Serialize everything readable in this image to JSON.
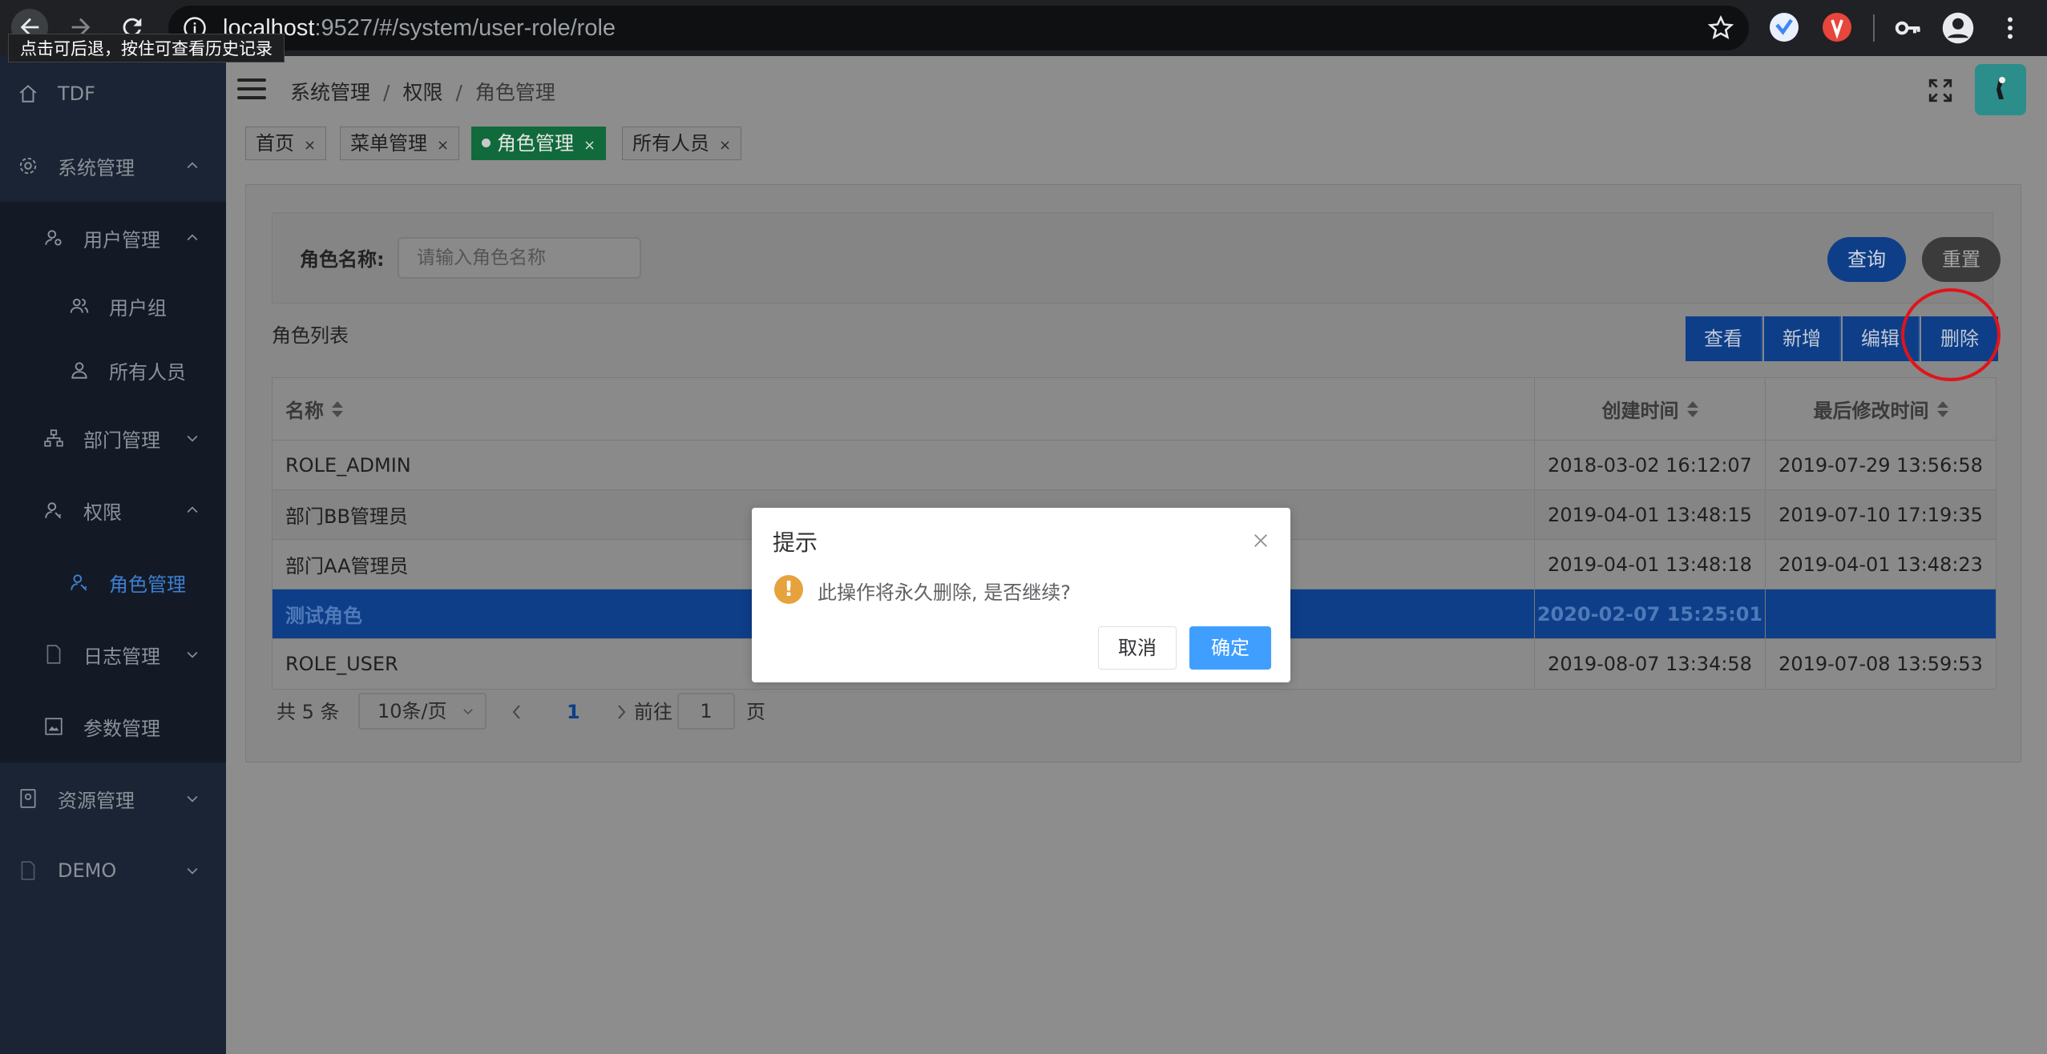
{
  "browser": {
    "url_host": "localhost",
    "url_rest": ":9527/#/system/user-role/role",
    "tooltip": "点击可后退，按住可查看历史记录"
  },
  "sidebar": {
    "items": [
      {
        "label": "TDF",
        "icon": "home-icon"
      },
      {
        "label": "系统管理",
        "icon": "gear-icon"
      },
      {
        "label": "用户管理",
        "icon": "user-gear-icon"
      },
      {
        "label": "用户组",
        "icon": "users-icon"
      },
      {
        "label": "所有人员",
        "icon": "user-icon"
      },
      {
        "label": "部门管理",
        "icon": "org-icon"
      },
      {
        "label": "权限",
        "icon": "user-key-icon"
      },
      {
        "label": "角色管理",
        "icon": "user-key-icon"
      },
      {
        "label": "日志管理",
        "icon": "doc-icon"
      },
      {
        "label": "参数管理",
        "icon": "picture-icon"
      },
      {
        "label": "资源管理",
        "icon": "book-icon"
      },
      {
        "label": "DEMO",
        "icon": "doc-icon"
      }
    ]
  },
  "breadcrumb": {
    "items": [
      "系统管理",
      "权限",
      "角色管理"
    ],
    "sep": "/"
  },
  "tags": [
    {
      "label": "首页",
      "close": "×"
    },
    {
      "label": "菜单管理",
      "close": "×"
    },
    {
      "label": "角色管理",
      "close": "×"
    },
    {
      "label": "所有人员",
      "close": "×"
    }
  ],
  "filter": {
    "label": "角色名称:",
    "placeholder": "请输入角色名称",
    "query_label": "查询",
    "reset_label": "重置"
  },
  "list": {
    "title": "角色列表",
    "actions": [
      "查看",
      "新增",
      "编辑",
      "删除"
    ],
    "columns": [
      "名称",
      "创建时间",
      "最后修改时间"
    ],
    "rows": [
      {
        "name": "ROLE_ADMIN",
        "created": "2018-03-02 16:12:07",
        "modified": "2019-07-29 13:56:58"
      },
      {
        "name": "部门BB管理员",
        "created": "2019-04-01 13:48:15",
        "modified": "2019-07-10 17:19:35"
      },
      {
        "name": "部门AA管理员",
        "created": "2019-04-01 13:48:18",
        "modified": "2019-04-01 13:48:23"
      },
      {
        "name": "测试角色",
        "created": "2020-02-07 15:25:01",
        "modified": ""
      },
      {
        "name": "ROLE_USER",
        "created": "2019-08-07 13:34:58",
        "modified": "2019-07-08 13:59:53"
      }
    ]
  },
  "pagination": {
    "total": "共 5 条",
    "page_size": "10条/页",
    "current": "1",
    "goto_prefix": "前往",
    "goto_value": "1",
    "goto_suffix": "页"
  },
  "dialog": {
    "title": "提示",
    "message": "此操作将永久删除, 是否继续?",
    "cancel": "取消",
    "confirm": "确定"
  },
  "colors": {
    "sidebar_bg": "#1b2434",
    "primary": "#409eff",
    "warning": "#e6a23c",
    "highlight_circle": "#e0141a"
  }
}
